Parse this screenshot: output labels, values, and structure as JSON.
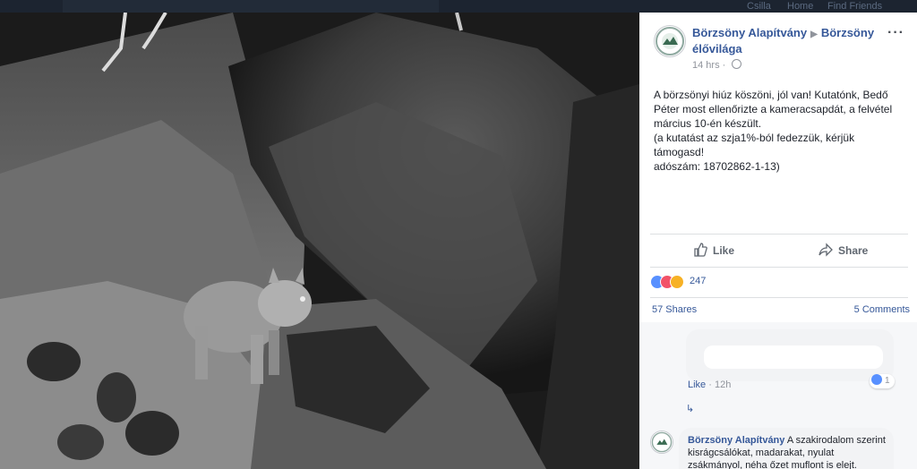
{
  "topbar": {
    "item1": "Csilla",
    "item2": "Home",
    "item3": "Find Friends"
  },
  "post": {
    "page_name": "Börzsöny Alapítvány",
    "target_name": "Börzsöny élővilága",
    "timestamp": "14 hrs",
    "text_lines": [
      "A börzsönyi hiúz köszöni, jól van! Kutatónk, Bedő Péter most ellenőrizte a kameracsapdát, a felvétel március 10-én készült.",
      "(a kutatást az szja1%-ból fedezzük, kérjük támogasd!",
      "adószám: 18702862-1-13)"
    ],
    "more_icon": "ellipsis-icon",
    "globe_icon": "globe-icon"
  },
  "actions": {
    "like": "Like",
    "share": "Share"
  },
  "reactions": {
    "count": "247",
    "icons": [
      "like-icon",
      "love-icon",
      "wow-icon"
    ]
  },
  "stats": {
    "shares": "57 Shares",
    "comments": "5 Comments"
  },
  "comment1": {
    "like_link": "Like",
    "time": "12h",
    "reaction_count": "1"
  },
  "comment2": {
    "author": "Börzsöny Alapítvány",
    "text": "A szakirodalom szerint kisrágcsálókat, madarakat, nyulat zsákmányol, néha őzet muflont is elejt."
  },
  "colors": {
    "link": "#365899",
    "secondary": "#90949c",
    "text": "#1d2129"
  }
}
